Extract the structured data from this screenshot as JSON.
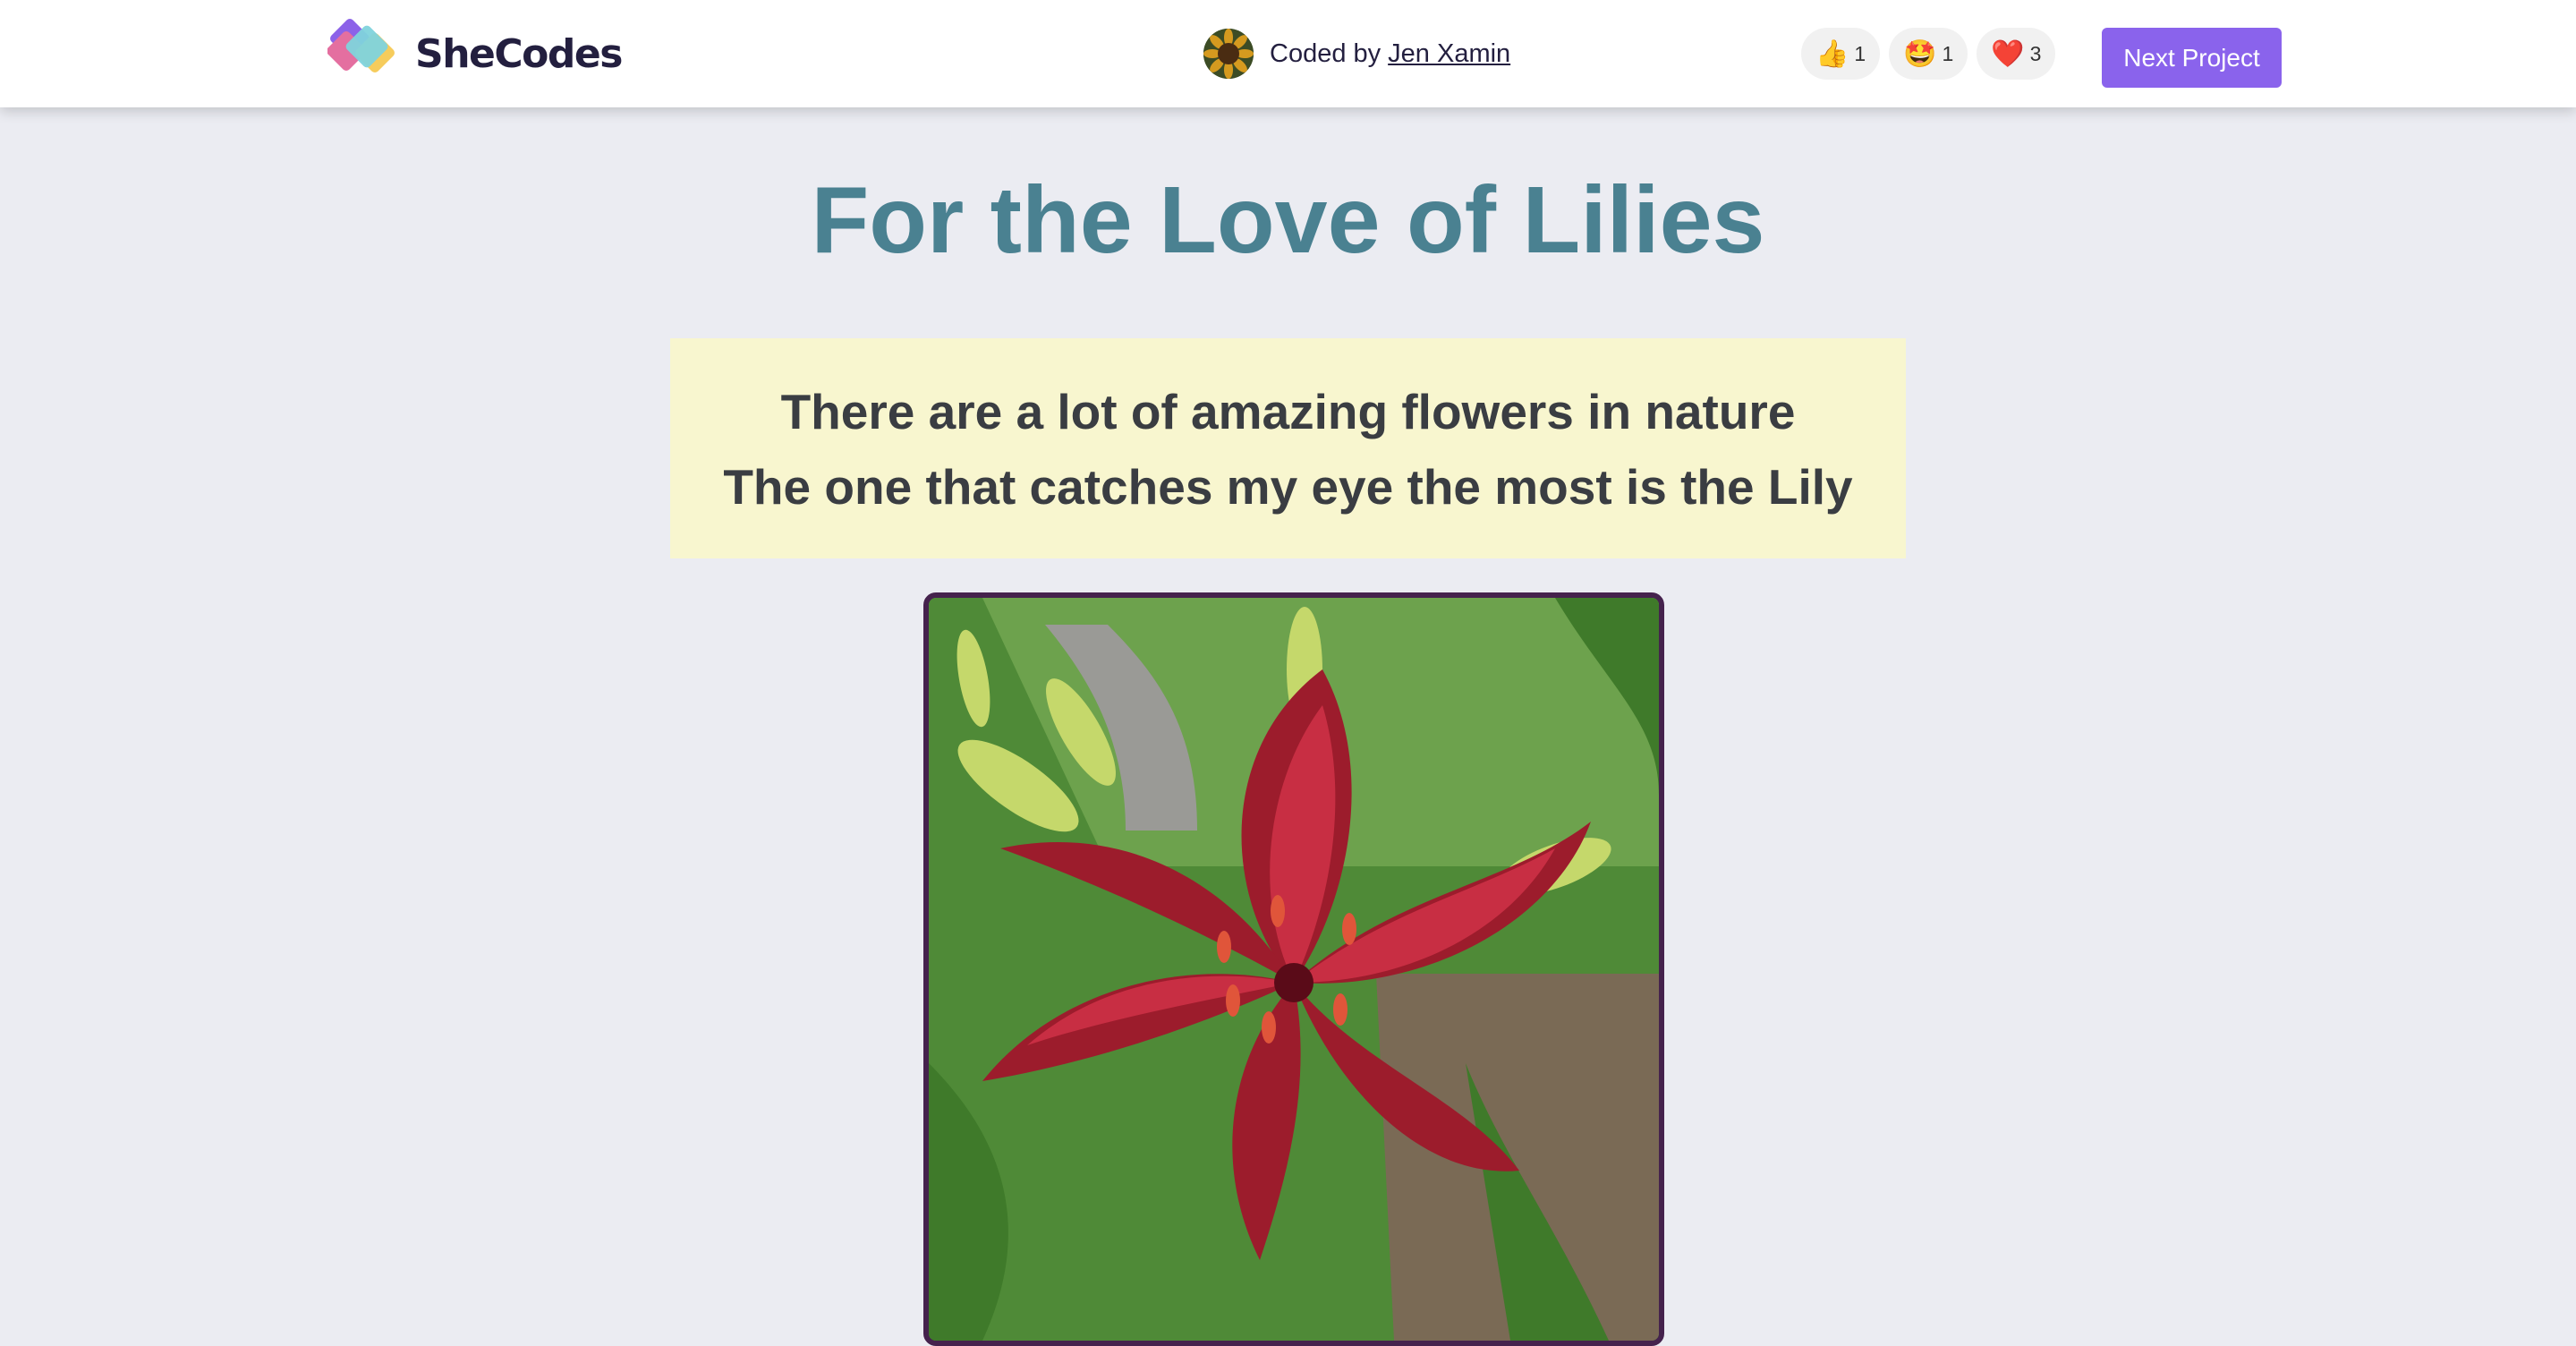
{
  "header": {
    "brand": "SheCodes",
    "coded_by_label": "Coded by",
    "author_name": "Jen Xamin",
    "reactions": [
      {
        "icon": "thumbs-up-icon",
        "emoji": "👍",
        "count": "1"
      },
      {
        "icon": "star-struck-icon",
        "emoji": "🤩",
        "count": "1"
      },
      {
        "icon": "heart-icon",
        "emoji": "❤️",
        "count": "3"
      }
    ],
    "next_button": "Next Project"
  },
  "main": {
    "title": "For the Love of Lilies",
    "intro_line_1": "There are a lot of amazing flowers in nature",
    "intro_line_2": "The one that catches my eye the most is the Lily"
  },
  "colors": {
    "background": "#ebecf2",
    "title": "#4a8191",
    "intro_bg": "#f8f6cf",
    "button": "#8a63ec",
    "photo_border": "#45224d"
  }
}
